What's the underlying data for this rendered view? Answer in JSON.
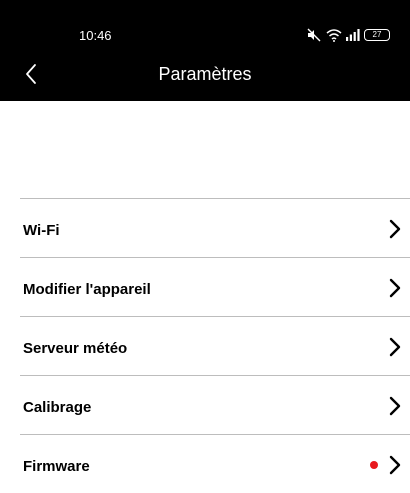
{
  "status_bar": {
    "time": "10:46",
    "battery": "27",
    "icons": [
      "mute-icon",
      "wifi-icon",
      "signal-icon",
      "battery-icon"
    ]
  },
  "header": {
    "title": "Paramètres",
    "back_icon": "chevron-left-icon"
  },
  "menu": {
    "items": [
      {
        "label": "Wi-Fi"
      },
      {
        "label": "Modifier l'appareil"
      },
      {
        "label": "Serveur météo"
      },
      {
        "label": "Calibrage"
      },
      {
        "label": "Firmware",
        "badge_color": "#e8191e"
      }
    ]
  },
  "colors": {
    "header_bg": "#000000",
    "divider": "#bdbdbd",
    "notification_dot": "#e8191e"
  }
}
